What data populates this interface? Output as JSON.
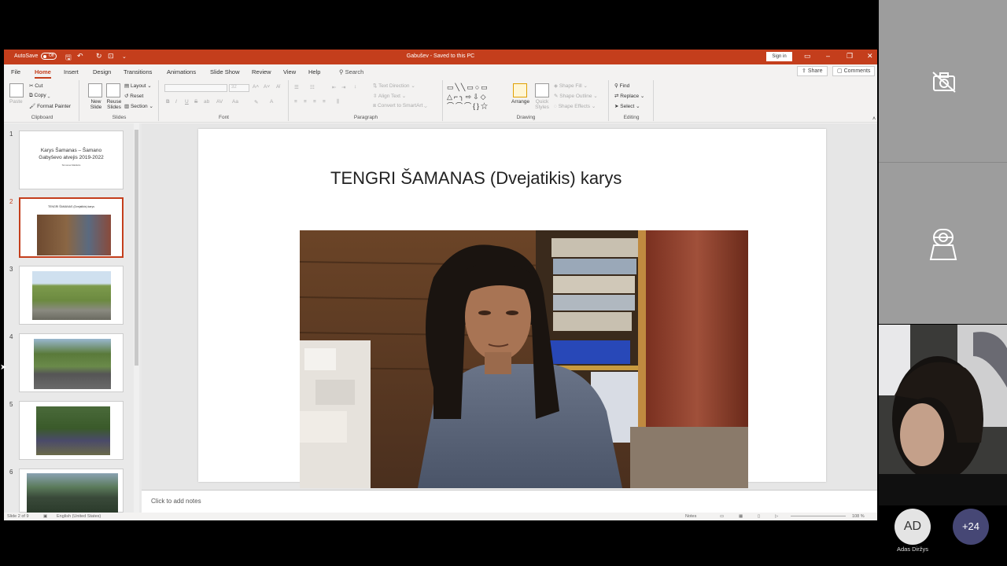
{
  "titlebar": {
    "autosave_label": "AutoSave",
    "autosave_state": "Off",
    "document_title": "Gabušev - Saved to this PC",
    "signin_label": "Sign in",
    "accent_color": "#c43e1c"
  },
  "menu": {
    "tabs": [
      "File",
      "Home",
      "Insert",
      "Design",
      "Transitions",
      "Animations",
      "Slide Show",
      "Review",
      "View",
      "Help"
    ],
    "active_tab": "Home",
    "search_label": "Search",
    "share_label": "Share",
    "comments_label": "Comments"
  },
  "ribbon": {
    "clipboard": {
      "label": "Clipboard",
      "paste": "Paste",
      "cut": "Cut",
      "copy": "Copy",
      "format_painter": "Format Painter"
    },
    "slides": {
      "label": "Slides",
      "new_slide": "New Slide",
      "reuse_slides": "Reuse Slides",
      "layout": "Layout",
      "reset": "Reset",
      "section": "Section"
    },
    "font": {
      "label": "Font",
      "size": "32",
      "bold": "B",
      "italic": "I",
      "underline": "U",
      "strike": "S",
      "shadow": "ab",
      "spacing": "AV",
      "case": "Aa"
    },
    "paragraph": {
      "label": "Paragraph",
      "text_direction": "Text Direction",
      "align_text": "Align Text",
      "convert_smartart": "Convert to SmartArt"
    },
    "drawing": {
      "label": "Drawing",
      "arrange": "Arrange",
      "quick_styles": "Quick Styles",
      "shape_fill": "Shape Fill",
      "shape_outline": "Shape Outline",
      "shape_effects": "Shape Effects"
    },
    "editing": {
      "label": "Editing",
      "find": "Find",
      "replace": "Replace",
      "select": "Select"
    }
  },
  "slides_pane": {
    "thumbnails": [
      {
        "num": "1",
        "title": "Karys Šamanas – Šamano Gabyševo atvejis 2019-2022",
        "subtitle": "Simonas Maldutis"
      },
      {
        "num": "2",
        "title": "TENGRI ŠAMANAS (Dvejatikis) karys",
        "selected": true
      },
      {
        "num": "3"
      },
      {
        "num": "4"
      },
      {
        "num": "5"
      },
      {
        "num": "6"
      }
    ]
  },
  "slide": {
    "title": "TENGRI ŠAMANAS (Dvejatikis) karys"
  },
  "notes": {
    "placeholder": "Click to add notes"
  },
  "statusbar": {
    "slide_info": "Slide 2 of 9",
    "language": "English (United States)",
    "notes": "Notes",
    "zoom": "108 %"
  },
  "meeting": {
    "participant_initials": "AD",
    "participant_name": "Adas Diržys",
    "more_count": "+24"
  }
}
